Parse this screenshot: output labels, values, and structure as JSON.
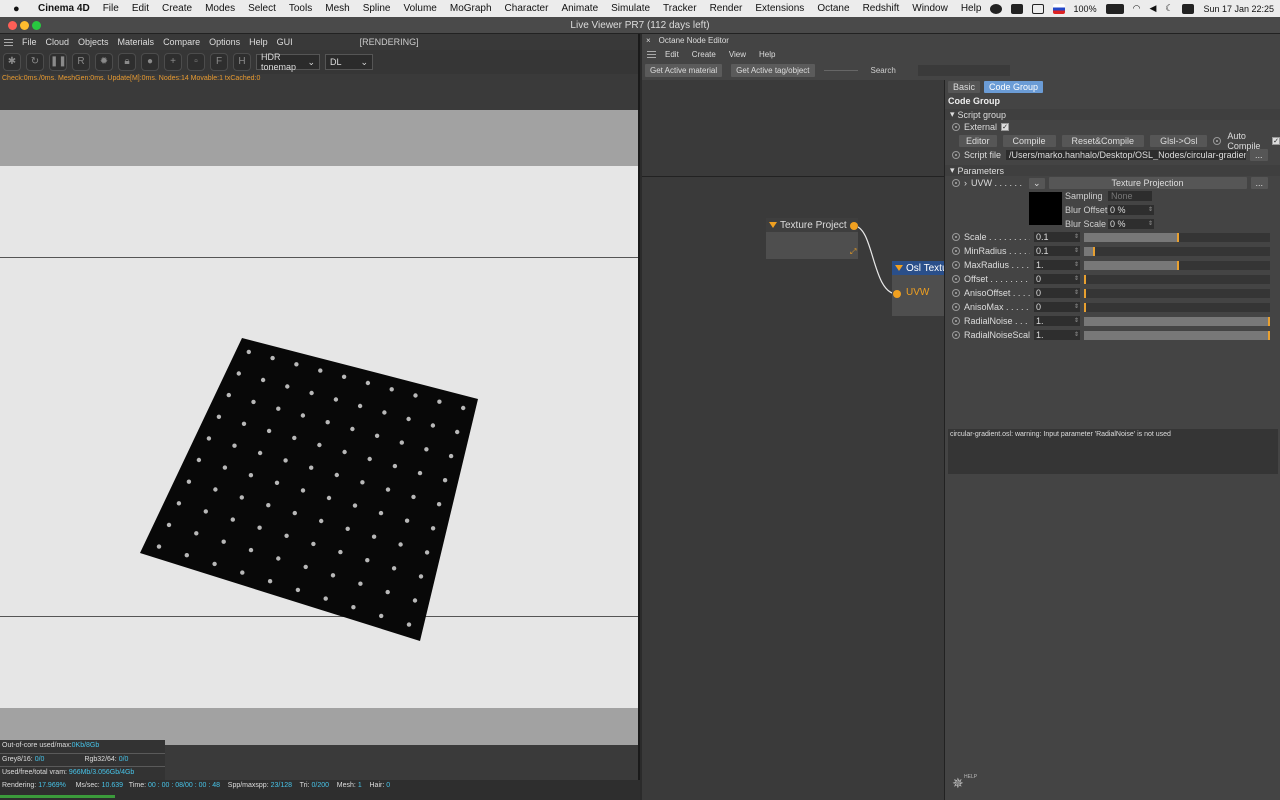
{
  "menubar": {
    "app": "Cinema 4D",
    "items": [
      "File",
      "Edit",
      "Create",
      "Modes",
      "Select",
      "Tools",
      "Mesh",
      "Spline",
      "Volume",
      "MoGraph",
      "Character",
      "Animate",
      "Simulate",
      "Tracker",
      "Render",
      "Extensions",
      "Octane",
      "Redshift",
      "Window",
      "Help"
    ],
    "battery": "100%",
    "datetime": "Sun 17 Jan  22:25"
  },
  "window": {
    "title": "Live Viewer PR7 (112 days left)"
  },
  "live_viewer": {
    "menu": [
      "File",
      "Cloud",
      "Objects",
      "Materials",
      "Compare",
      "Options",
      "Help",
      "GUI"
    ],
    "status": "[RENDERING]",
    "tonemap": "HDR tonemap",
    "mode": "DL",
    "info": "Check:0ms./0ms. MeshGen:0ms. Update[M]:0ms. Nodes:14 Movable:1 txCached:0",
    "stats": {
      "ooc_label": "Out-of-core used/max:",
      "ooc_val": "0Kb/8Gb",
      "grey_label": "Grey8/16:",
      "grey_val": "0/0",
      "rgb_label": "Rgb32/64:",
      "rgb_val": "0/0",
      "vram_label": "Used/free/total vram:",
      "vram_val": "966Mb/3.056Gb/4Gb"
    },
    "render": {
      "rendering_label": "Rendering:",
      "rendering_val": "17.969%",
      "ms_label": "Ms/sec:",
      "ms_val": "10.639",
      "time_label": "Time:",
      "time_val": "00 : 00 : 08/00 : 00 : 48",
      "spp_label": "Spp/maxspp:",
      "spp_val": "23/128",
      "tri_label": "Tri:",
      "tri_val": "0/200",
      "mesh_label": "Mesh:",
      "mesh_val": "1",
      "hair_label": "Hair:",
      "hair_val": "0",
      "progress": 0.18
    }
  },
  "node_editor": {
    "title": "Octane Node Editor",
    "menu": [
      "Edit",
      "Create",
      "View",
      "Help"
    ],
    "get_material": "Get Active material",
    "get_tag": "Get Active tag/object",
    "search_label": "Search",
    "nodes": {
      "texture": "Texture Project",
      "osl": "Osl Textu",
      "uvw": "UVW"
    }
  },
  "props": {
    "tabs": [
      "Basic",
      "Code Group"
    ],
    "section": "Code Group",
    "script_group": "Script group",
    "external": "External",
    "buttons": [
      "Editor",
      "Compile",
      "Reset&Compile",
      "Glsl->Osl"
    ],
    "auto_compile": "Auto Compile",
    "script_file_label": "Script file",
    "script_file": "/Users/marko.hanhalo/Desktop/OSL_Nodes/circular-gradient.osl",
    "more": "...",
    "parameters": "Parameters",
    "uvw_label": "UVW . . . . . . . .",
    "uvw_value": "Texture Projection",
    "sampling_label": "Sampling",
    "sampling_value": "None",
    "blur_offset_label": "Blur Offset",
    "blur_offset": "0 %",
    "blur_scale_label": "Blur Scale",
    "blur_scale": "0 %",
    "params": [
      {
        "label": "Scale . . . . . . . . .",
        "value": "0.1",
        "fill": 0.5
      },
      {
        "label": "MinRadius . . . . . .",
        "value": "0.1",
        "fill": 0.05
      },
      {
        "label": "MaxRadius . . . . . .",
        "value": "1.",
        "fill": 0.5
      },
      {
        "label": "Offset . . . . . . . .",
        "value": "0",
        "fill": 0
      },
      {
        "label": "AnisoOffset . . . . .",
        "value": "0",
        "fill": 0
      },
      {
        "label": "AnisoMax . . . . . .",
        "value": "0",
        "fill": 0
      },
      {
        "label": "RadialNoise . . . . .",
        "value": "1.",
        "fill": 1
      },
      {
        "label": "RadialNoiseScale .",
        "value": "1.",
        "fill": 1
      }
    ],
    "warning": "circular-gradient.osl: warning: Input parameter 'RadialNoise' is not used",
    "help": "HELP"
  },
  "colors": {
    "accent": "#f0a020",
    "tab_active": "#6b9cd6",
    "info_text": "#e89a30",
    "stat_value": "#47c3e8"
  }
}
